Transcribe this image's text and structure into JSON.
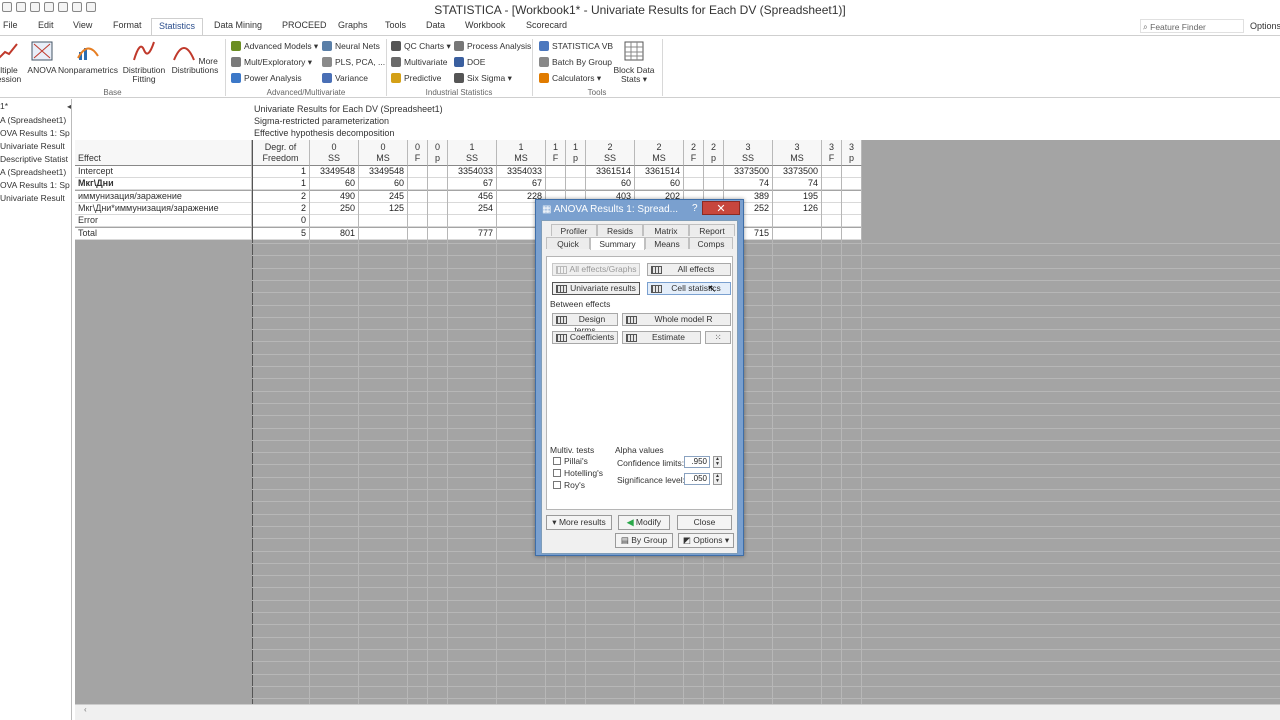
{
  "window": {
    "title": "STATISTICA - [Workbook1* - Univariate Results for Each DV (Spreadsheet1)]"
  },
  "menu": [
    "File",
    "Edit",
    "View",
    "Format",
    "Statistics",
    "Data Mining",
    "PROCEED",
    "Graphs",
    "Tools",
    "Data",
    "Workbook",
    "Scorecard"
  ],
  "menu_active": "Statistics",
  "feature_finder": "Feature Finder",
  "options_top": "Options",
  "ribbon": {
    "base": {
      "label": "Base",
      "buttons": [
        "ltiple\nession",
        "ANOVA",
        "Nonparametrics",
        "Distribution\nFitting",
        "More\nDistributions"
      ]
    },
    "advanced": {
      "label": "Advanced/Multivariate",
      "items": [
        "Advanced Models ▾",
        "Mult/Exploratory ▾",
        "Power Analysis",
        "Neural Nets",
        "PLS, PCA, ...",
        "Variance"
      ]
    },
    "industrial": {
      "label": "Industrial Statistics",
      "items": [
        "QC Charts ▾",
        "Multivariate",
        "Predictive",
        "Process Analysis",
        "DOE",
        "Six Sigma ▾"
      ]
    },
    "tools": {
      "label": "Tools",
      "items": [
        "STATISTICA VB",
        "Batch By Group",
        "Calculators ▾"
      ],
      "block": "Block Data\nStats ▾"
    }
  },
  "left_panel": [
    "1*",
    "A (Spreadsheet1)",
    "OVA Results 1: Sp",
    "Univariate Result",
    "Descriptive Statist",
    "A (Spreadsheet1)",
    "OVA Results 1: Sp",
    "Univariate Result"
  ],
  "sheet": {
    "header_lines": [
      "Univariate Results for Each DV (Spreadsheet1)",
      "Sigma-restricted parameterization",
      "Effective hypothesis decomposition"
    ],
    "effect_label": "Effect",
    "columns": [
      {
        "top": "Degr. of",
        "bot": "Freedom"
      },
      {
        "top": "0",
        "bot": "SS"
      },
      {
        "top": "0",
        "bot": "MS"
      },
      {
        "top": "0",
        "bot": "F"
      },
      {
        "top": "0",
        "bot": "p"
      },
      {
        "top": "1",
        "bot": "SS"
      },
      {
        "top": "1",
        "bot": "MS"
      },
      {
        "top": "1",
        "bot": "F"
      },
      {
        "top": "1",
        "bot": "p"
      },
      {
        "top": "2",
        "bot": "SS"
      },
      {
        "top": "2",
        "bot": "MS"
      },
      {
        "top": "2",
        "bot": "F"
      },
      {
        "top": "2",
        "bot": "p"
      },
      {
        "top": "3",
        "bot": "SS"
      },
      {
        "top": "3",
        "bot": "MS"
      },
      {
        "top": "3",
        "bot": "F"
      },
      {
        "top": "3",
        "bot": "p"
      }
    ],
    "rows": [
      {
        "label": "Intercept",
        "cells": [
          "1",
          "3349548",
          "3349548",
          "",
          "",
          "3354033",
          "3354033",
          "",
          "",
          "3361514",
          "3361514",
          "",
          "",
          "3373500",
          "3373500",
          "",
          ""
        ]
      },
      {
        "label": "Мкг\\Дни",
        "bold": true,
        "cells": [
          "1",
          "60",
          "60",
          "",
          "",
          "67",
          "67",
          "",
          "",
          "60",
          "60",
          "",
          "",
          "74",
          "74",
          "",
          ""
        ]
      },
      {
        "label": "иммунизация/заражение",
        "cells": [
          "2",
          "490",
          "245",
          "",
          "",
          "456",
          "228",
          "",
          "",
          "403",
          "202",
          "",
          "",
          "389",
          "195",
          "",
          ""
        ]
      },
      {
        "label": "Мкг\\Дни*иммунизация/заражение",
        "cells": [
          "2",
          "250",
          "125",
          "",
          "",
          "254",
          "",
          "",
          "",
          "",
          "",
          "",
          "",
          "252",
          "126",
          "",
          ""
        ]
      },
      {
        "label": "Error",
        "cells": [
          "0",
          "",
          "",
          "",
          "",
          "",
          "",
          "",
          "",
          "",
          "",
          "",
          "",
          "",
          "",
          "",
          ""
        ]
      },
      {
        "label": "Total",
        "cells": [
          "5",
          "801",
          "",
          "",
          "",
          "777",
          "",
          "",
          "",
          "",
          "",
          "",
          "",
          "715",
          "",
          "",
          ""
        ]
      }
    ]
  },
  "dialog": {
    "title": "ANOVA Results 1: Spread...",
    "help": "?",
    "tabs_row1": [
      "Profiler",
      "Resids",
      "Matrix",
      "Report"
    ],
    "tabs_row2": [
      "Quick",
      "Summary",
      "Means",
      "Comps"
    ],
    "active_tab": "Summary",
    "btn_all_effects_graphs": "All effects/Graphs",
    "btn_all_effects": "All effects",
    "btn_univariate": "Univariate results",
    "btn_cell_stats": "Cell statistics",
    "between_effects": "Between effects",
    "btn_design_terms": "Design terms",
    "btn_whole_model": "Whole model R",
    "btn_coefficients": "Coefficients",
    "btn_estimate": "Estimate",
    "multiv_tests": "Multiv. tests",
    "tests": [
      "Pillai's",
      "Hotelling's",
      "Roy's"
    ],
    "alpha_values": "Alpha values",
    "confidence_label": "Confidence limits:",
    "confidence_value": ".950",
    "significance_label": "Significance level:",
    "significance_value": ".050",
    "btn_more_results": "More results",
    "btn_modify": "Modify",
    "btn_close": "Close",
    "btn_by_group": "By Group",
    "btn_options": "Options ▾"
  },
  "colors": {
    "accent": "#2b4e8c",
    "dialog_frame": "#7aa0cf",
    "close_red": "#c7463d",
    "modify_green": "#2aa84a"
  }
}
